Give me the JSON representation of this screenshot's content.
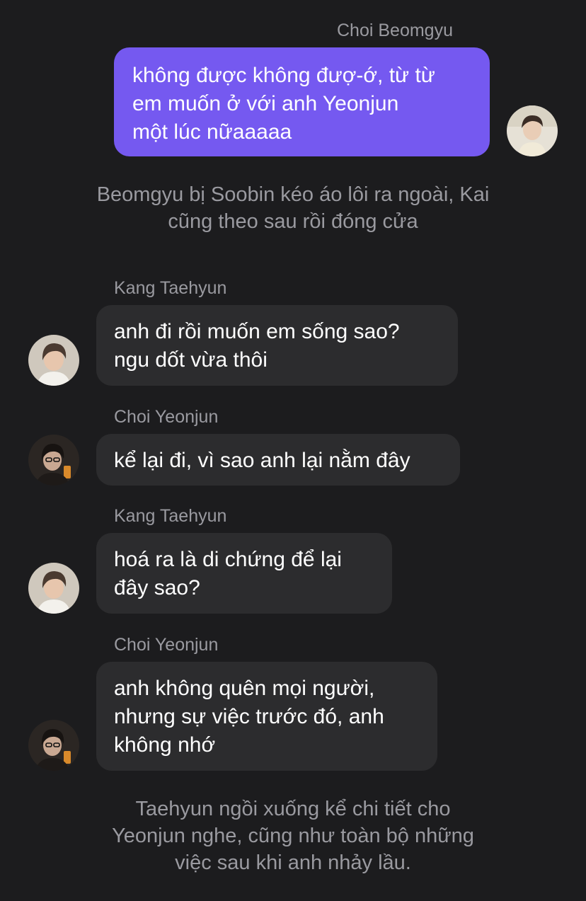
{
  "messages": [
    {
      "sender": "Choi Beomgyu",
      "avatar_icon": "beomgyu-avatar",
      "lines": [
        "không được không đượ-ớ, từ từ",
        "em muốn ở với anh Yeonjun",
        "một lúc nữaaaaa"
      ]
    },
    {
      "sender": "Kang Taehyun",
      "avatar_icon": "taehyun-avatar",
      "lines": [
        "anh đi rồi muốn em sống sao?",
        "ngu dốt vừa thôi"
      ]
    },
    {
      "sender": "Choi Yeonjun",
      "avatar_icon": "yeonjun-avatar",
      "lines": [
        "kể lại đi, vì sao anh lại nằm đây"
      ]
    },
    {
      "sender": "Kang Taehyun",
      "avatar_icon": "taehyun-avatar",
      "lines": [
        "hoá ra là di chứng để lại",
        "đây sao?"
      ]
    },
    {
      "sender": "Choi Yeonjun",
      "avatar_icon": "yeonjun-avatar",
      "lines": [
        "anh không quên mọi người,",
        "nhưng sự việc trước đó, anh",
        "không nhớ"
      ]
    }
  ],
  "narrations": [
    {
      "lines": [
        "Beomgyu bị Soobin kéo áo lôi ra ngoài, Kai",
        "cũng theo sau rồi đóng cửa"
      ]
    },
    {
      "lines": [
        "Taehyun ngồi xuống kể chi tiết cho",
        "Yeonjun nghe, cũng như toàn bộ những",
        "việc sau khi anh nhảy lầu."
      ]
    }
  ],
  "colors": {
    "background": "#1c1c1e",
    "outgoing_bubble": "#7559f0",
    "incoming_bubble": "#2c2c2e",
    "secondary_text": "#9a9aa0"
  }
}
